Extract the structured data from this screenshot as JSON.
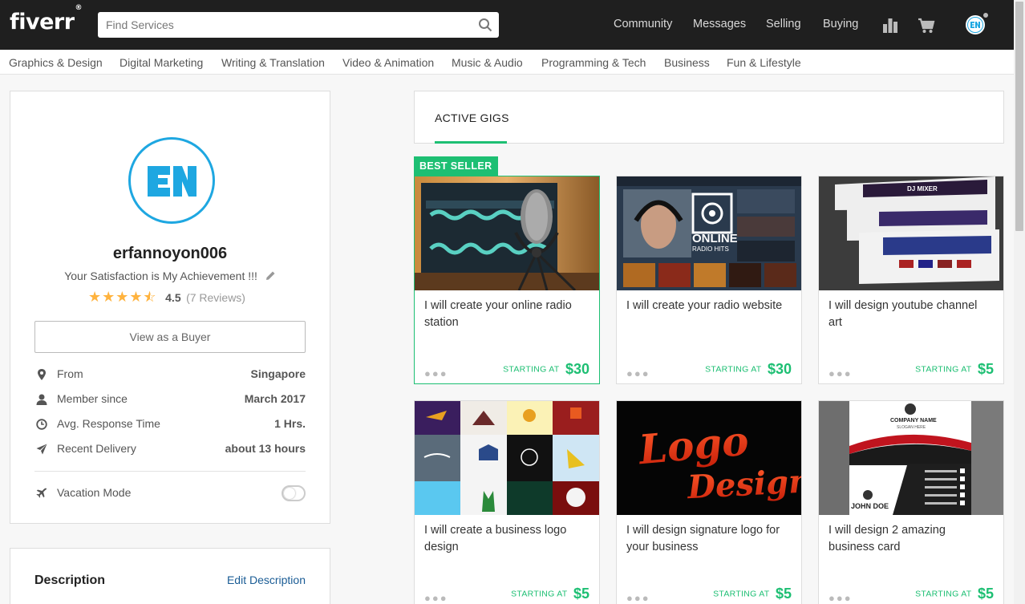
{
  "header": {
    "logo": "fiverr",
    "logo_mark": "®",
    "search_placeholder": "Find Services",
    "nav": [
      "Community",
      "Messages",
      "Selling",
      "Buying"
    ],
    "avatar_initials": "EN"
  },
  "categories": [
    "Graphics & Design",
    "Digital Marketing",
    "Writing & Translation",
    "Video & Animation",
    "Music & Audio",
    "Programming & Tech",
    "Business",
    "Fun & Lifestyle"
  ],
  "profile": {
    "username": "erfannoyon006",
    "tagline": "Your Satisfaction is My Achievement !!!",
    "rating": "4.5",
    "reviews": "(7 Reviews)",
    "rating_stars": 4.5,
    "view_as_buyer": "View as a Buyer",
    "from_label": "From",
    "from_value": "Singapore",
    "member_label": "Member since",
    "member_value": "March 2017",
    "response_label": "Avg. Response Time",
    "response_value": "1 Hrs.",
    "delivery_label": "Recent Delivery",
    "delivery_value": "about 13 hours",
    "vacation_label": "Vacation Mode",
    "vacation_on": false
  },
  "description": {
    "title": "Description",
    "edit": "Edit Description"
  },
  "gigs": {
    "tab": "ACTIVE GIGS",
    "badge": "BEST SELLER",
    "price_label": "STARTING AT",
    "items": [
      {
        "title": "I will create your online radio station",
        "price": "$30"
      },
      {
        "title": "I will create your radio website",
        "price": "$30"
      },
      {
        "title": "I will design youtube channel art",
        "price": "$5"
      },
      {
        "title": "I will create a business logo design",
        "price": "$5"
      },
      {
        "title": "I will design signature logo for your business",
        "price": "$5"
      },
      {
        "title": "I will design 2 amazing business card",
        "price": "$5"
      }
    ],
    "img_text": {
      "radio_online": "ONLINE",
      "radio_sub": "RADIO HITS",
      "dj": "DJ MIXER",
      "logo_word1": "Logo",
      "logo_word2": "Design",
      "card_company": "COMPANY NAME",
      "card_slogan": "SLOGAN HERE",
      "card_name": "JOHN DOE"
    }
  },
  "colors": {
    "brand_green": "#1dbf73",
    "topbar": "#1f1f1f",
    "avatar_blue": "#1ea7e1",
    "star": "#ffb33e"
  }
}
